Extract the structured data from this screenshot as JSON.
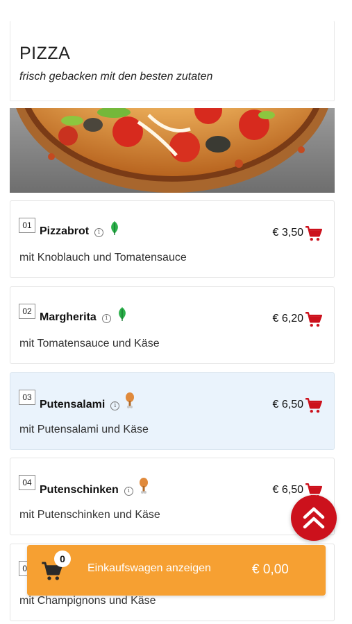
{
  "category": {
    "title": "PIZZA",
    "subtitle": "frisch gebacken mit den besten zutaten"
  },
  "items": [
    {
      "number": "01",
      "name": "Pizzabrot",
      "price": "€ 3,50",
      "description": "mit Knoblauch und Tomatensauce",
      "tag_icon": "leaf-icon"
    },
    {
      "number": "02",
      "name": "Margherita",
      "price": "€ 6,20",
      "description": "mit Tomatensauce und Käse",
      "tag_icon": "leaf-icon"
    },
    {
      "number": "03",
      "name": "Putensalami",
      "price": "€ 6,50",
      "description": "mit Putensalami und Käse",
      "tag_icon": "drumstick-icon"
    },
    {
      "number": "04",
      "name": "Putenschinken",
      "price": "€ 6,50",
      "description": "mit Putenschinken und Käse",
      "tag_icon": "drumstick-icon"
    },
    {
      "number": "05",
      "name": "",
      "price": "",
      "description": "mit Champignons und Käse",
      "tag_icon": ""
    }
  ],
  "cart": {
    "count": "0",
    "label": "Einkaufswagen anzeigen",
    "total": "€ 0,00"
  },
  "colors": {
    "accent_red": "#cc111c",
    "cart_bar": "#f6a032",
    "veg_green": "#2bb04a",
    "meat_orange": "#e08a3c",
    "highlight_row": "#eaf3fc"
  }
}
